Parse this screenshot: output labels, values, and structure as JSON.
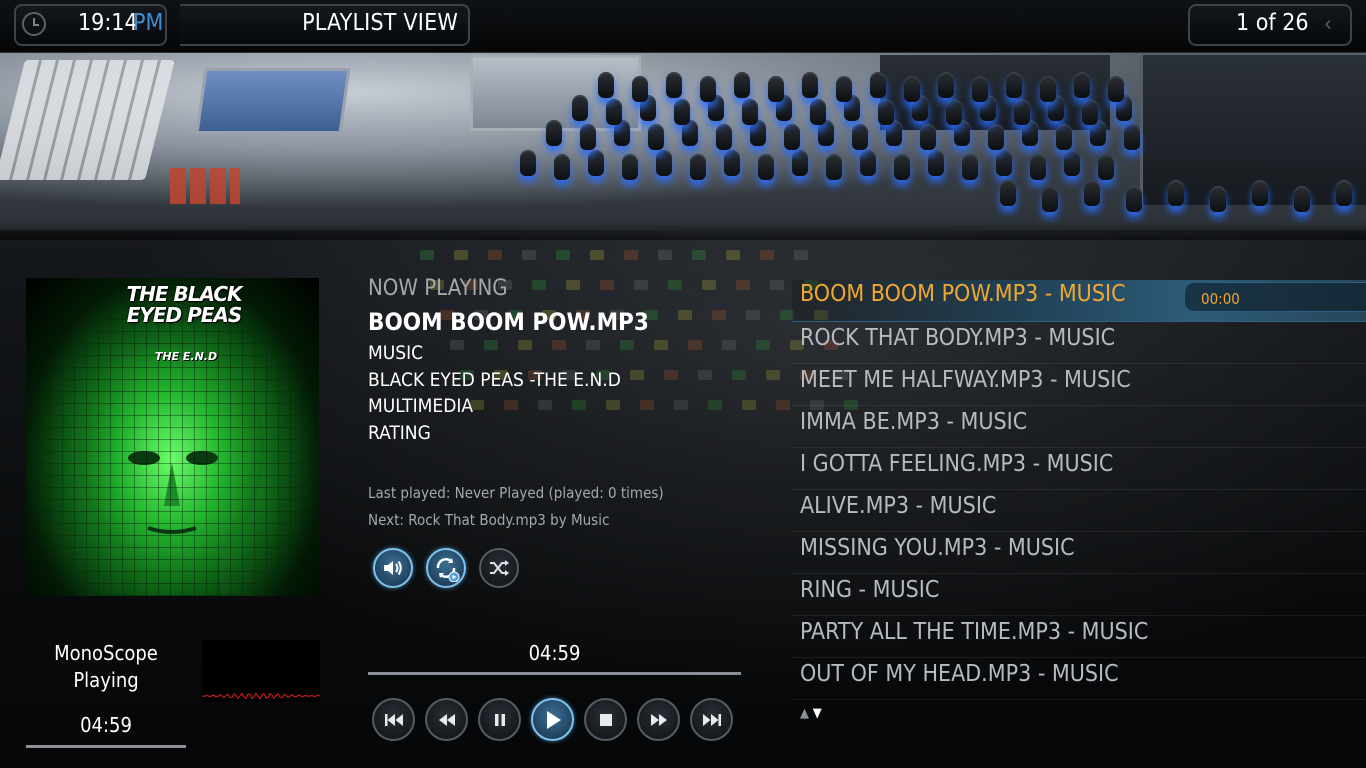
{
  "header": {
    "time": "19:14",
    "ampm": "PM",
    "view_title": "PLAYLIST VIEW",
    "page_count": "1 of 26"
  },
  "album_art": {
    "band_text": "THE BLACK EYED PEAS",
    "album_text": "THE E.N.D"
  },
  "now_playing": {
    "label": "NOW PLAYING",
    "title": "BOOM BOOM POW.MP3",
    "artist": "MUSIC",
    "album": "BLACK EYED PEAS -THE E.N.D",
    "genre": "MULTIMEDIA",
    "rating": "RATING",
    "last_played": "Last played: Never Played (played: 0 times)",
    "next": "Next: Rock That Body.mp3 by Music"
  },
  "visualisation": {
    "name": "MonoScope",
    "status": "Playing",
    "time": "04:59",
    "wave_color": "#e0201c"
  },
  "player": {
    "elapsed": "04:59",
    "controls": [
      "volume-icon",
      "repeat-icon",
      "shuffle-icon",
      "previous-icon",
      "rewind-icon",
      "pause-icon",
      "play-icon",
      "stop-icon",
      "fast-forward-icon",
      "next-icon"
    ]
  },
  "playlist": {
    "items": [
      {
        "label": "BOOM BOOM POW.MP3 - MUSIC",
        "duration": "00:00"
      },
      {
        "label": "ROCK THAT BODY.MP3 - MUSIC"
      },
      {
        "label": "MEET ME HALFWAY.MP3 - MUSIC"
      },
      {
        "label": "IMMA BE.MP3 - MUSIC"
      },
      {
        "label": "I GOTTA FEELING.MP3 - MUSIC"
      },
      {
        "label": "ALIVE.MP3 - MUSIC"
      },
      {
        "label": "MISSING YOU.MP3 - MUSIC"
      },
      {
        "label": "RING - MUSIC"
      },
      {
        "label": "PARTY ALL THE TIME.MP3 - MUSIC"
      },
      {
        "label": "OUT OF MY HEAD.MP3 - MUSIC"
      }
    ],
    "selected_index": 0
  },
  "colors": {
    "accent_blue": "#3d8fd6",
    "selected_text": "#f0a830",
    "muted_text": "#a4a9af"
  }
}
